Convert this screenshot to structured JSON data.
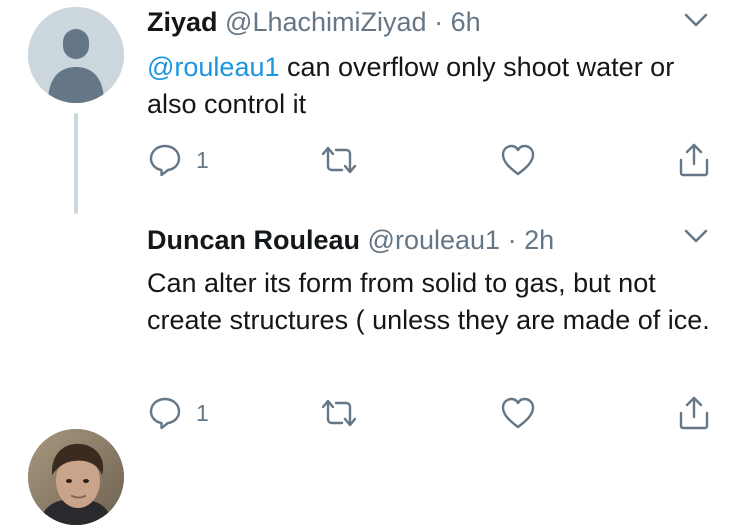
{
  "tweets": [
    {
      "display_name": "Ziyad",
      "handle": "@LhachimiZiyad",
      "separator": "·",
      "time": "6h",
      "mention": "@rouleau1",
      "text": " can overflow only shoot water or also control it",
      "reply_count": "1",
      "avatar": "default-avatar-icon"
    },
    {
      "display_name": "Duncan Rouleau",
      "handle": "@rouleau1",
      "separator": "·",
      "time": "2h",
      "mention": "",
      "text": "Can alter its form from solid to gas, but not create structures ( unless they are made of ice.",
      "reply_count": "1",
      "avatar": "user-photo"
    }
  ],
  "colors": {
    "text": "#14171a",
    "secondary": "#657786",
    "link": "#1b95e0",
    "avatar_placeholder": "#ccd6dd"
  },
  "icons": [
    "chevron-down-icon",
    "reply-icon",
    "retweet-icon",
    "like-icon",
    "share-icon"
  ]
}
